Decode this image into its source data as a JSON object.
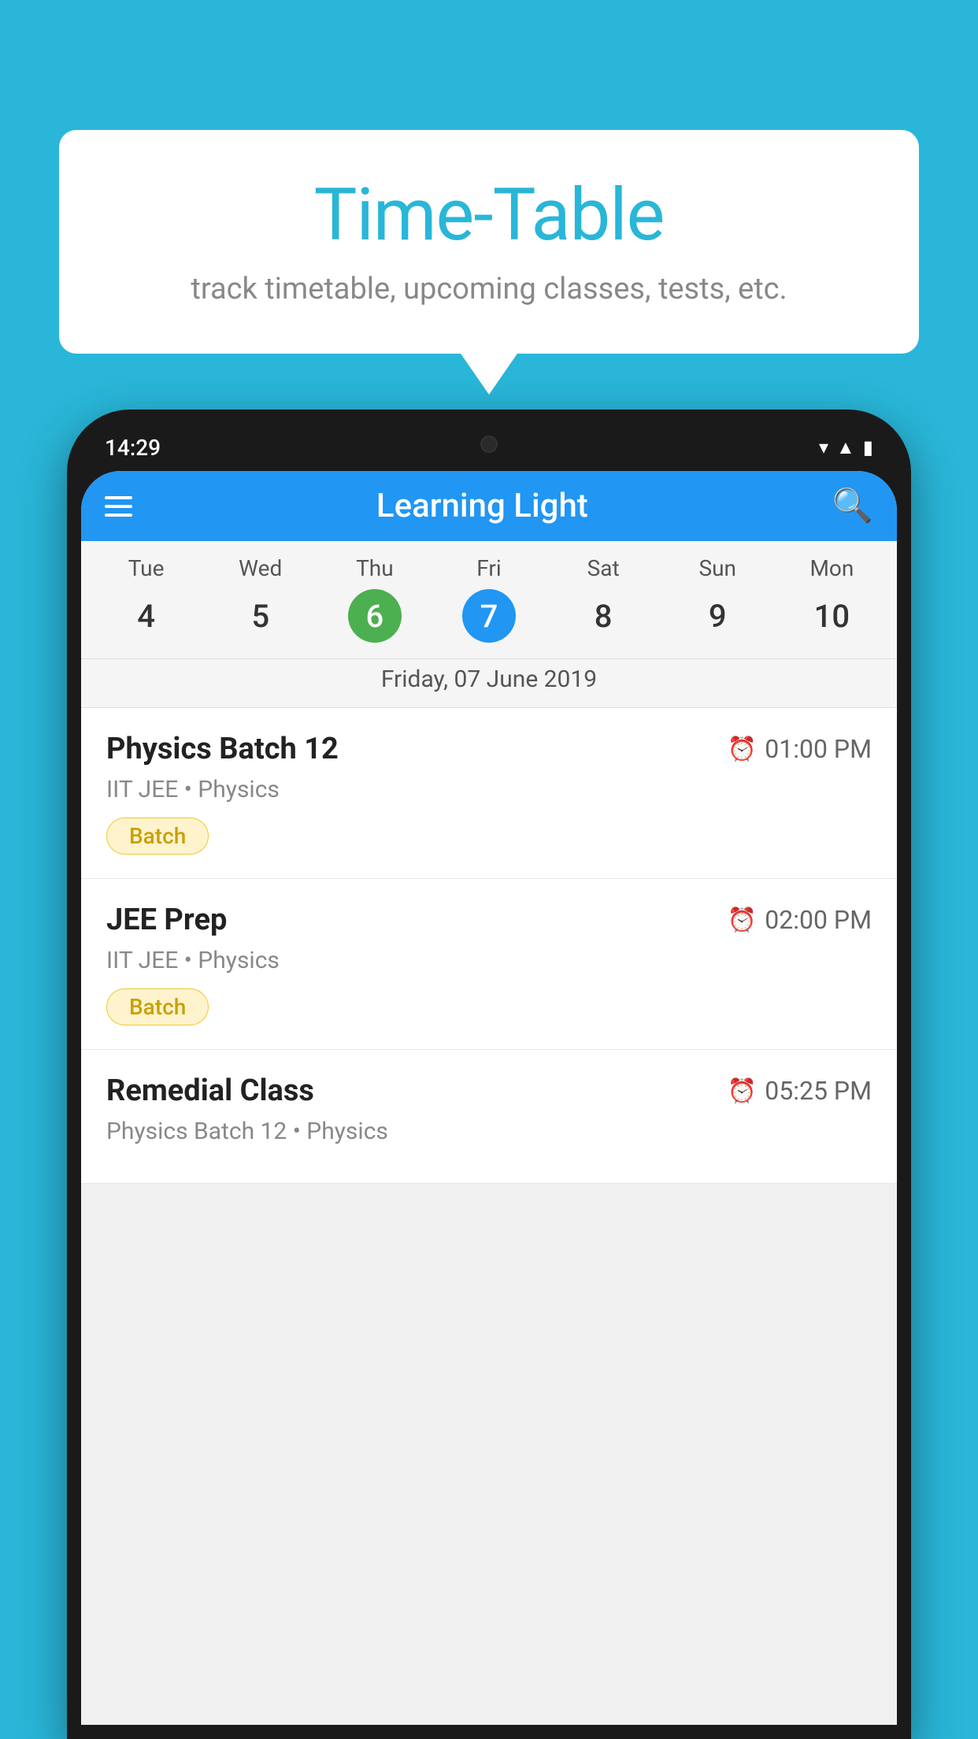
{
  "background": {
    "color": "#29b6d8"
  },
  "speech_bubble": {
    "title": "Time-Table",
    "subtitle": "track timetable, upcoming classes, tests, etc."
  },
  "phone": {
    "status_bar": {
      "time": "14:29"
    },
    "app_header": {
      "title": "Learning Light"
    },
    "calendar": {
      "day_headers": [
        "Tue",
        "Wed",
        "Thu",
        "Fri",
        "Sat",
        "Sun",
        "Mon"
      ],
      "day_numbers": [
        {
          "num": "4",
          "state": "normal"
        },
        {
          "num": "5",
          "state": "normal"
        },
        {
          "num": "6",
          "state": "today"
        },
        {
          "num": "7",
          "state": "selected"
        },
        {
          "num": "8",
          "state": "normal"
        },
        {
          "num": "9",
          "state": "normal"
        },
        {
          "num": "10",
          "state": "normal"
        }
      ],
      "selected_date": "Friday, 07 June 2019"
    },
    "classes": [
      {
        "name": "Physics Batch 12",
        "time": "01:00 PM",
        "detail": "IIT JEE • Physics",
        "badge": "Batch"
      },
      {
        "name": "JEE Prep",
        "time": "02:00 PM",
        "detail": "IIT JEE • Physics",
        "badge": "Batch"
      },
      {
        "name": "Remedial Class",
        "time": "05:25 PM",
        "detail": "Physics Batch 12 • Physics",
        "badge": ""
      }
    ]
  }
}
